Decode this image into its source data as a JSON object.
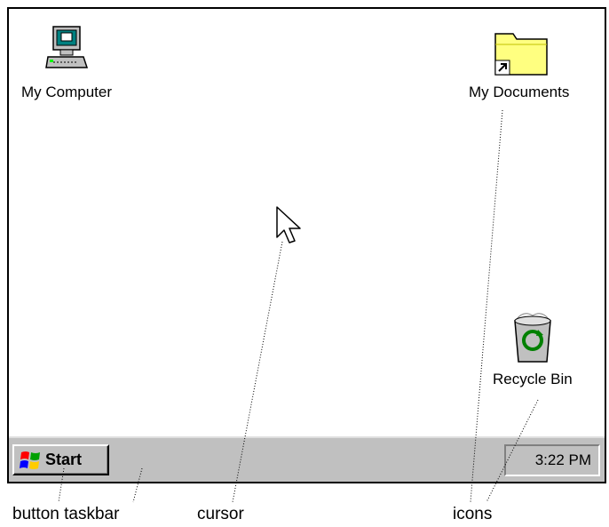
{
  "desktop": {
    "icons": [
      {
        "label": "My Computer",
        "icon": "my-computer-icon"
      },
      {
        "label": "My Documents",
        "icon": "folder-shortcut-icon"
      },
      {
        "label": "Recycle Bin",
        "icon": "recycle-bin-icon"
      }
    ],
    "cursor": "arrow-cursor-icon"
  },
  "taskbar": {
    "start_label": "Start",
    "clock": "3:22 PM",
    "start_logo": "windows-flag-icon"
  },
  "callouts": {
    "button_taskbar": "button taskbar",
    "cursor": "cursor",
    "icons": "icons"
  },
  "colors": {
    "taskbar": "#c0c0c0",
    "folder": "#ffff80",
    "monitor_screen": "#008080"
  }
}
